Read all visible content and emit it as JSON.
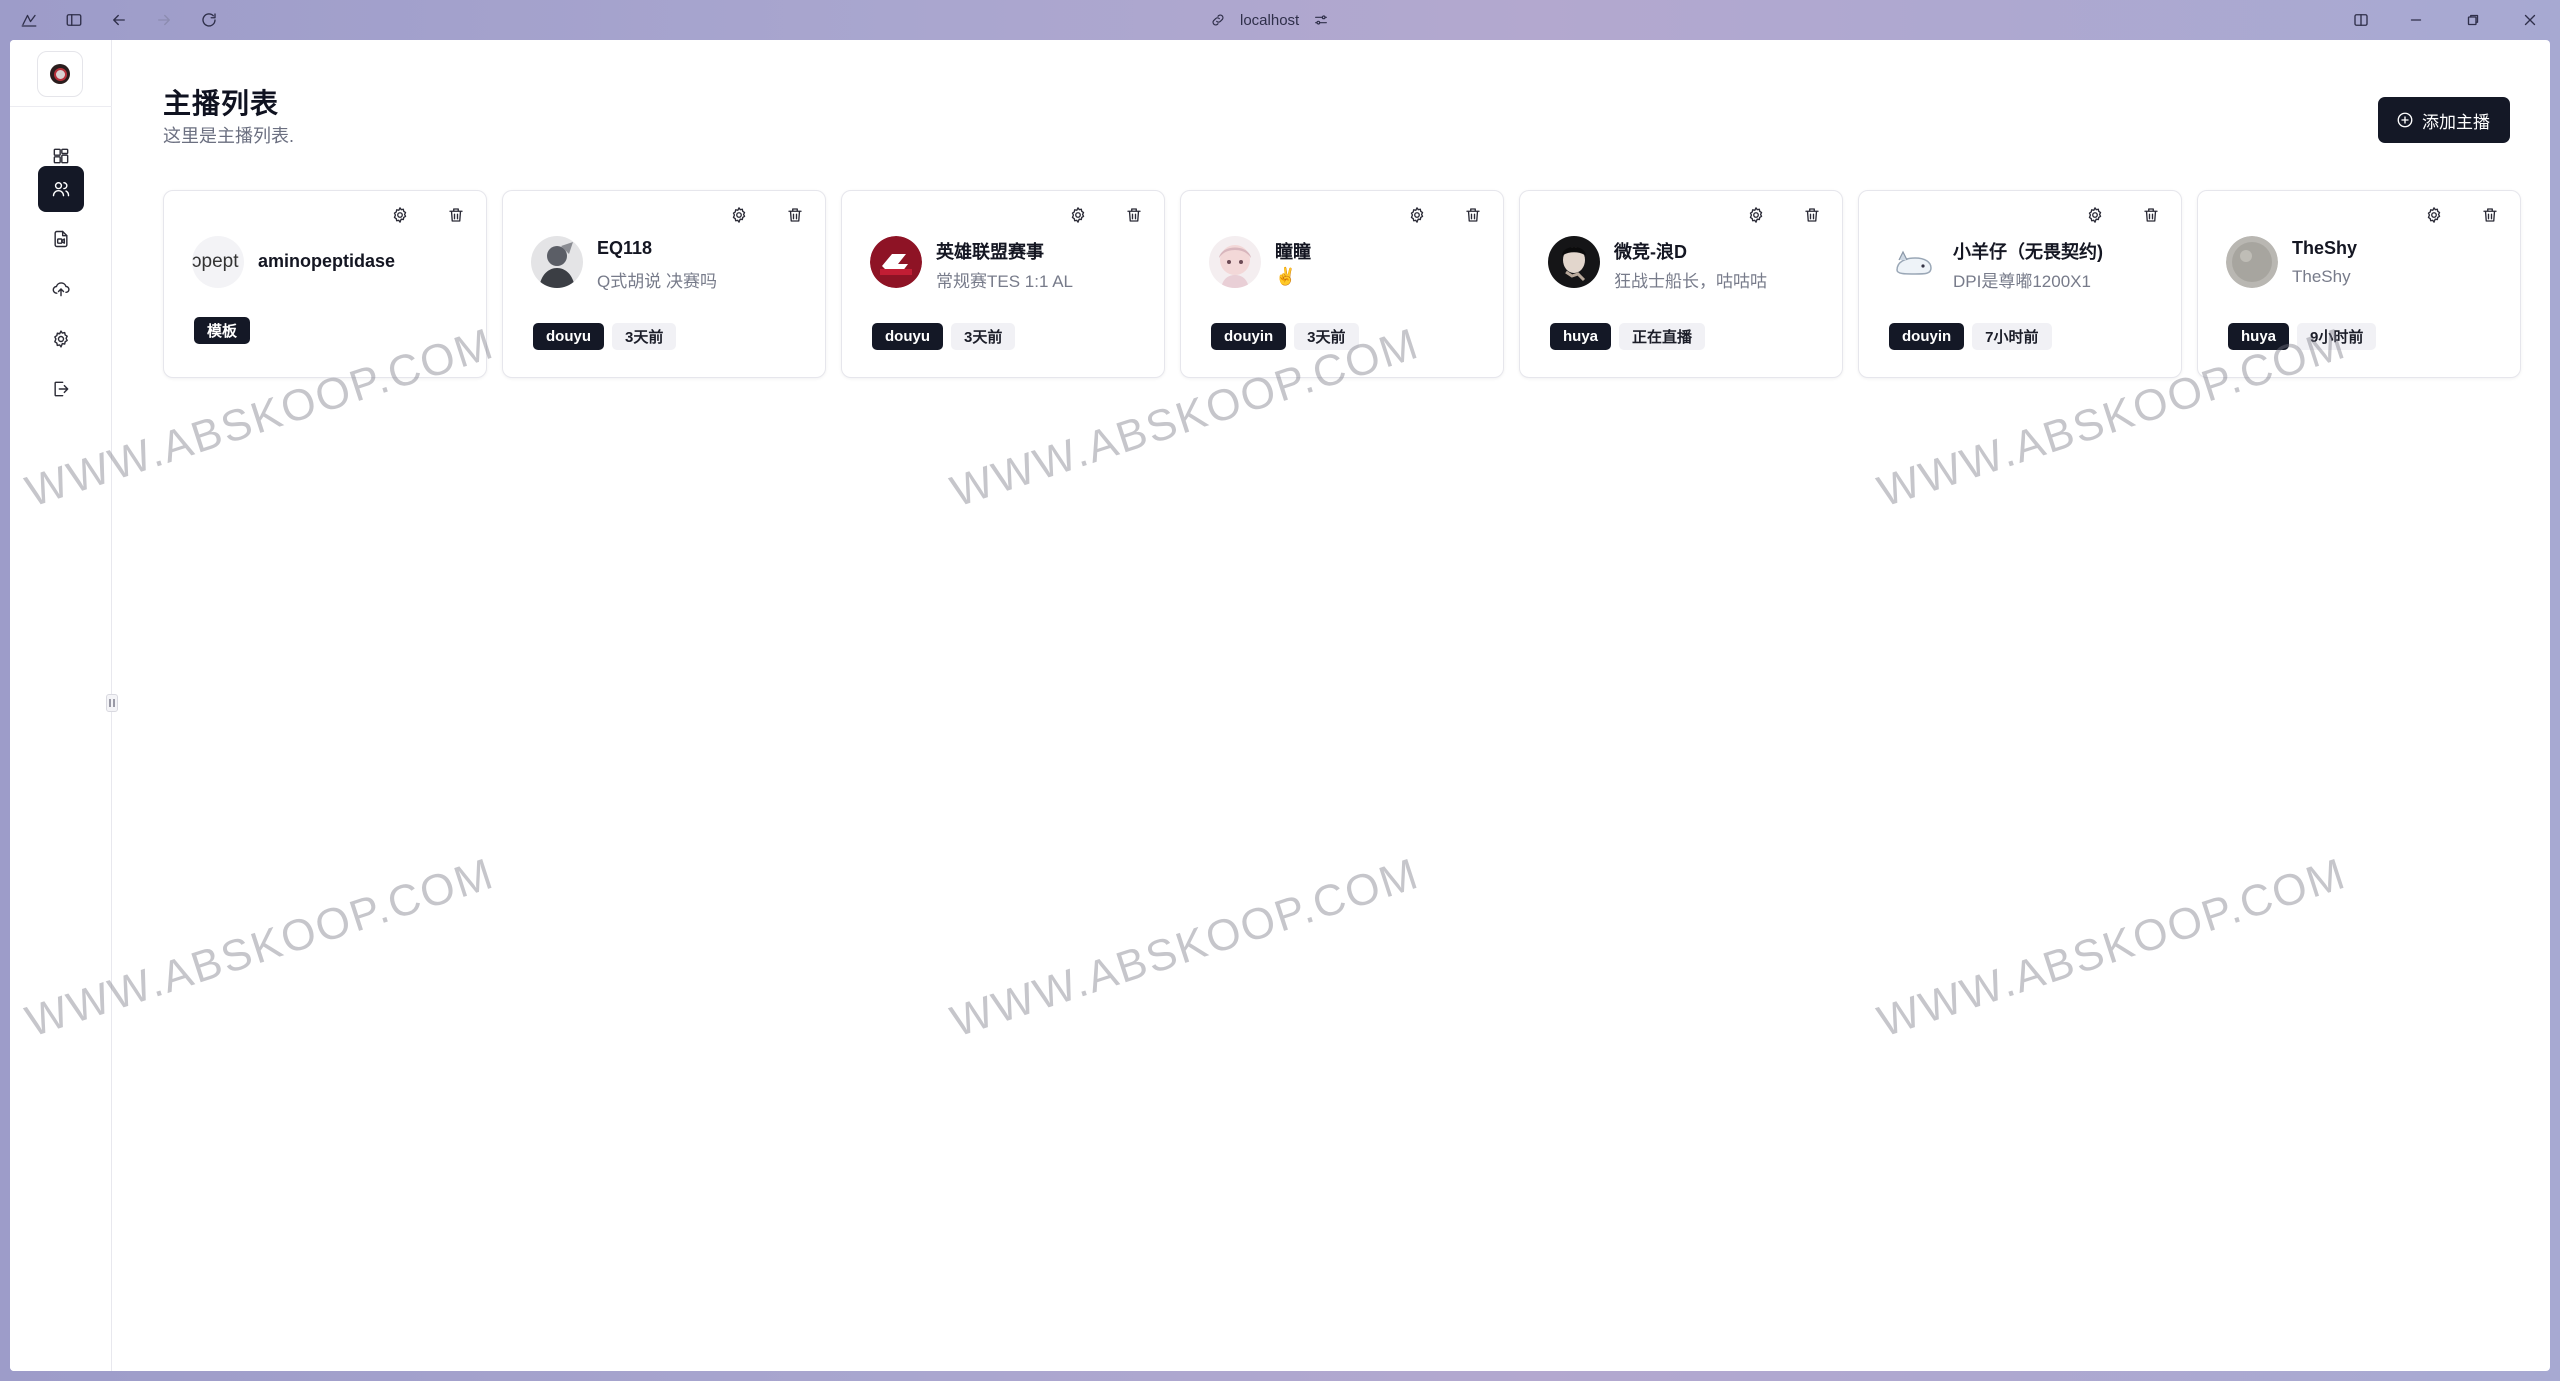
{
  "browser": {
    "url": "localhost",
    "icons": [
      "app-menu-icon",
      "sidebar-toggle-icon",
      "back-icon",
      "forward-icon",
      "reload-icon",
      "link-icon",
      "tune-icon",
      "split-view-icon",
      "minimize-icon",
      "restore-icon",
      "close-icon"
    ]
  },
  "sidebar": {
    "items": [
      {
        "name": "dashboard",
        "icon": "dashboard-grid-icon",
        "active": false
      },
      {
        "name": "streamers",
        "icon": "users-icon",
        "active": true
      },
      {
        "name": "records",
        "icon": "file-video-icon",
        "active": false
      },
      {
        "name": "upload",
        "icon": "cloud-upload-icon",
        "active": false
      },
      {
        "name": "settings",
        "icon": "gear-icon",
        "active": false
      },
      {
        "name": "logout",
        "icon": "logout-icon",
        "active": false
      }
    ]
  },
  "page": {
    "title": "主播列表",
    "subtitle": "这里是主播列表.",
    "add_button": "添加主播"
  },
  "cards": [
    {
      "avatar_text": "ɔpept",
      "name": "aminopeptidase",
      "desc": "",
      "tags": [
        "模板"
      ]
    },
    {
      "name": "EQ118",
      "desc": "Q式胡说 决赛吗",
      "tags": [
        "douyu",
        "3天前"
      ]
    },
    {
      "name": "英雄联盟赛事",
      "desc": "常规赛TES 1:1 AL",
      "tags": [
        "douyu",
        "3天前"
      ]
    },
    {
      "name": "瞳瞳",
      "desc": "✌️",
      "tags": [
        "douyin",
        "3天前"
      ]
    },
    {
      "name": "微竞-浪D",
      "desc": "狂战士船长，咕咕咕",
      "tags": [
        "huya",
        "正在直播"
      ]
    },
    {
      "name": "小羊仔（无畏契约)",
      "desc": "DPI是尊嘟1200X1",
      "tags": [
        "douyin",
        "7小时前"
      ]
    },
    {
      "name": "TheShy",
      "desc": "TheShy",
      "tags": [
        "huya",
        "9小时前"
      ]
    }
  ],
  "watermark": "WWW.ABSKOOP.COM",
  "colors": {
    "primary": "#141826",
    "muted_text": "#777b8a",
    "border": "#e6e6ec"
  }
}
